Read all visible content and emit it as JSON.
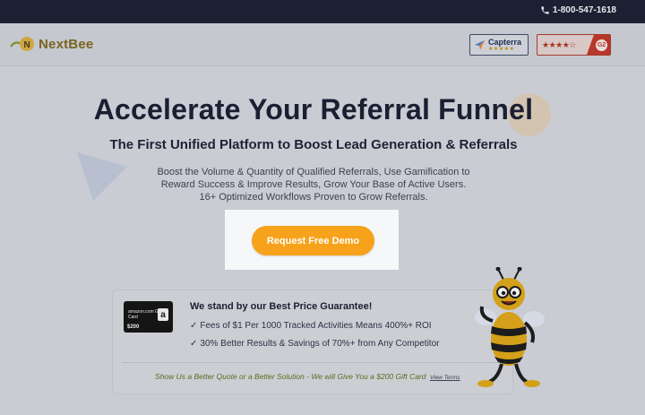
{
  "topbar": {
    "phone": "1-800-547-1618",
    "phone_icon": "phone-icon"
  },
  "header": {
    "brand": "NextBee",
    "logo_icon": "nextbee-logo-icon",
    "capterra": {
      "name": "Capterra",
      "stars": "★★★★★"
    },
    "g2": {
      "stars": "★★★★☆",
      "logo": "G2"
    }
  },
  "hero": {
    "headline": "Accelerate Your Referral Funnel",
    "subheadline": "The First Unified Platform to Boost Lead Generation & Referrals",
    "description": "Boost the Volume & Quantity of Qualified Referrals, Use Gamification to Reward Success & Improve Results, Grow Your Base of Active Users. 16+ Optimized Workflows Proven to Grow Referrals.",
    "cta_label": "Request Free Demo"
  },
  "guarantee": {
    "giftcard_brand": "amazon.com Gift Card",
    "giftcard_value": "$200",
    "title": "We stand by our Best Price Guarantee!",
    "items": [
      "Fees of $1 Per 1000 Tracked Activities Means 400%+ ROI",
      "30% Better Results & Savings of 70%+ from Any Competitor"
    ],
    "footer": "Show Us a Better Quote or a Better Solution - We will Give You a $200 Gift Card",
    "terms_link": "View Terms"
  },
  "colors": {
    "topbar": "#1b2032",
    "cta": "#f7a21b",
    "headline": "#1b1f33"
  }
}
